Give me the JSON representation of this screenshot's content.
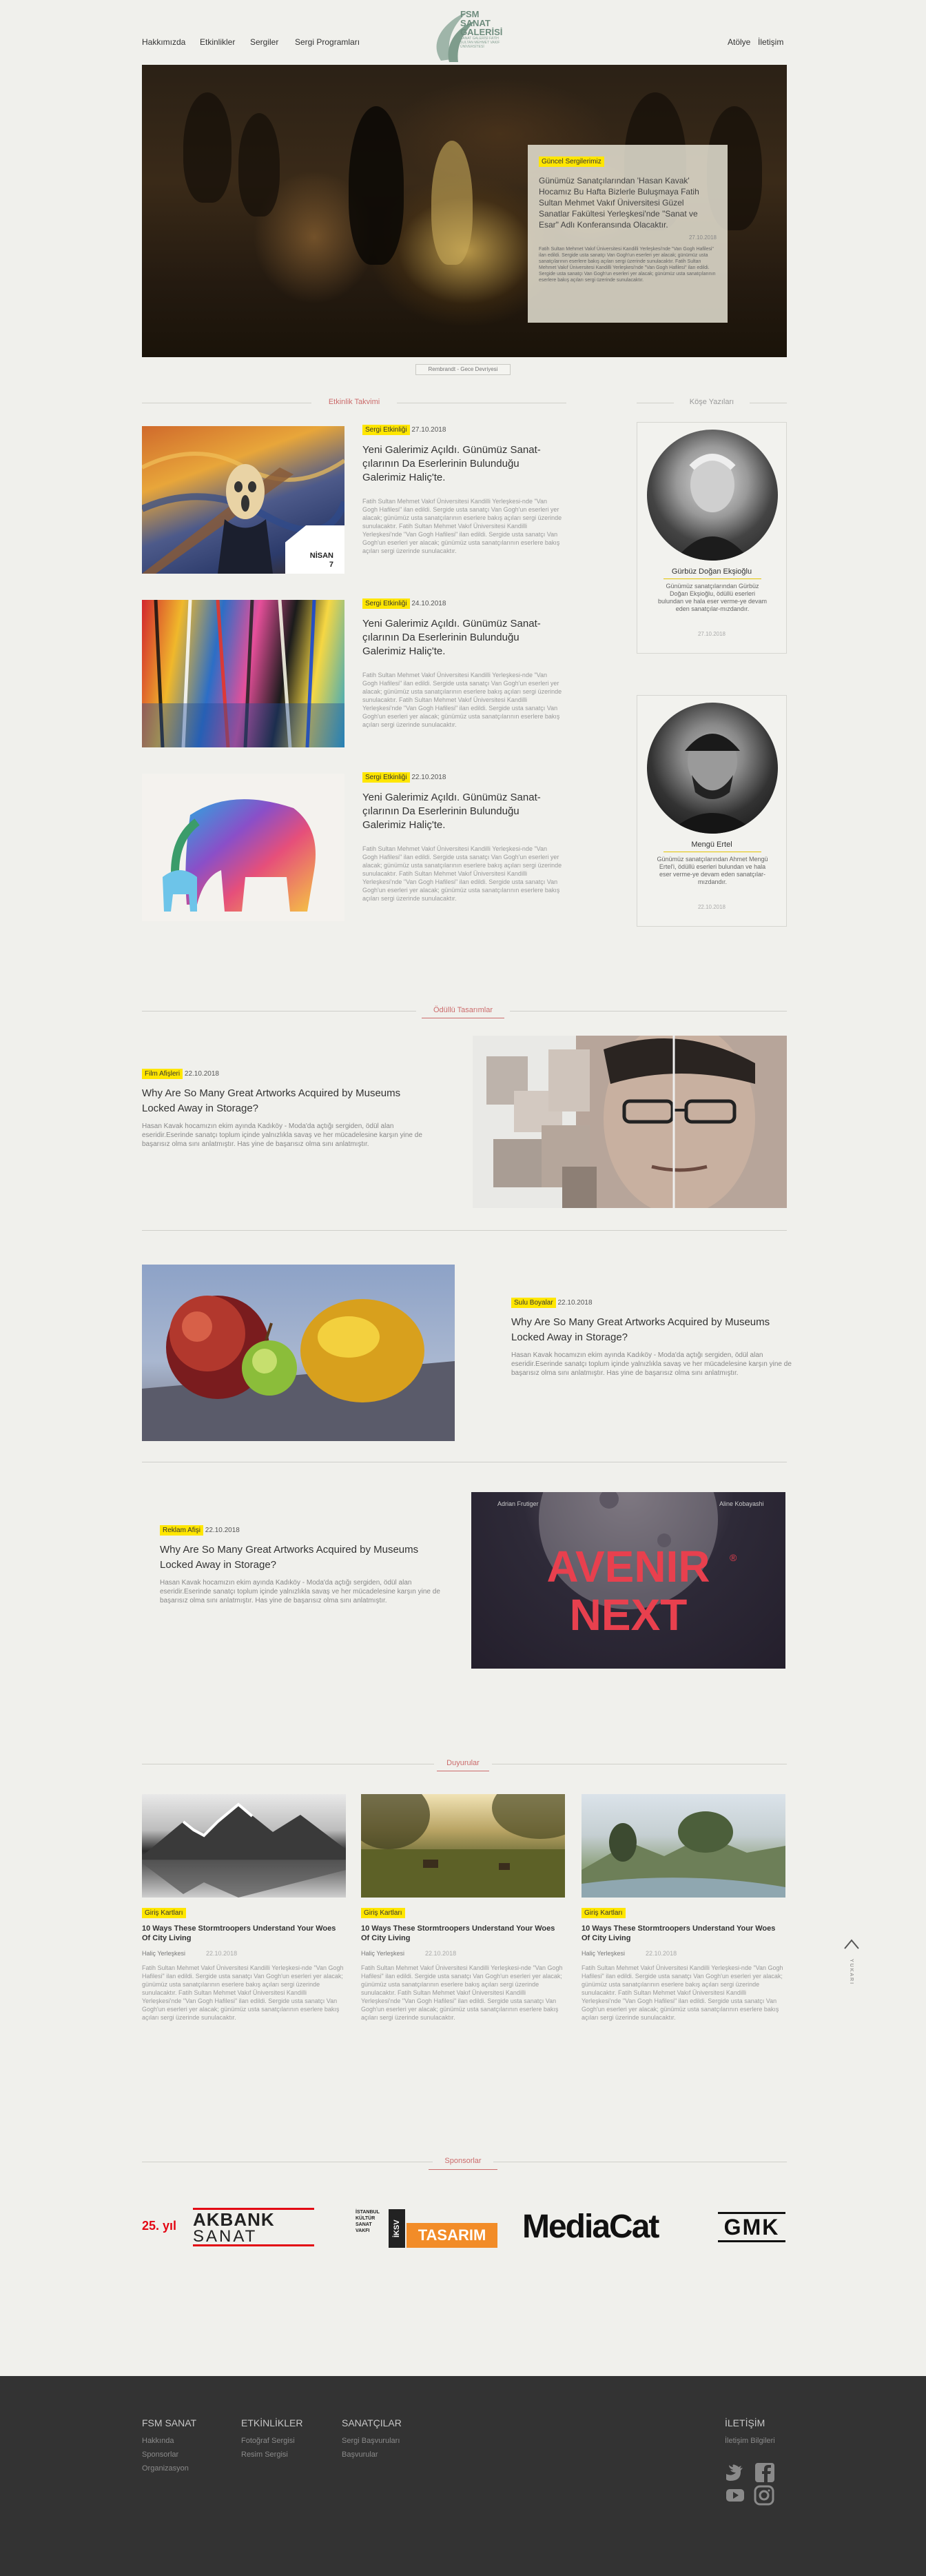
{
  "header": {
    "nav_left": [
      "Hakkımızda",
      "Etkinlikler",
      "Sergiler",
      "Sergi Programları"
    ],
    "nav_right": [
      "Atölye",
      "İletişim"
    ],
    "logo": {
      "line1": "FSM",
      "line2": "SANAT",
      "line3": "GALERİSİ",
      "sub": "SANAT GALERİSİ FATİH SULTAN MEHMET VAKIF ÜNİVERSİTESİ"
    }
  },
  "hero": {
    "tag": "Güncel Sergilerimiz",
    "title": "Günümüz Sanatçılarından 'Hasan Kavak' Hocamız Bu Hafta Bizlerle Buluşmaya Fatih Sultan Mehmet Vakıf Üniversitesi Güzel Sanatlar Fakültesi Yerleşkesi'nde \"Sanat ve Esar\" Adlı Konferansında Olacaktır.",
    "date": "27.10.2018",
    "body": "Fatih Sultan Mehmet Vakıf Üniversitesi Kandilli Yerleşkesi'nde \"Van Gogh Hafilesi\" ilan edildi. Sergide usta sanatçı Van Gogh'un eserleri yer alacak; günümüz usta sanatçılarının eserlere bakış açıları sergi üzerinde sunulacaktır. Fatih Sultan Mehmet Vakıf Üniversitesi Kandilli Yerleşkesi'nde \"Van Gogh Hafilesi\" ilan edildi. Sergide usta sanatçı Van Gogh'un eserleri yer alacak; günümüz usta sanatçılarının eserlere bakış açıları sergi üzerinde sunulacaktır.",
    "caption": "Rembrandt - Gece Devriyesi"
  },
  "sections": {
    "events": "Etkinlik Takvimi",
    "authors": "Köşe Yazıları",
    "awards": "Ödüllü Tasarımlar",
    "announcements": "Duyurular",
    "sponsors": "Sponsorlar"
  },
  "articles": [
    {
      "tag": "Sergi Etkinliği",
      "date": "27.10.2018",
      "title": "Yeni Galerimiz Açıldı. Günümüz Sanat-çılarının Da Eserlerinin Bulunduğu Galerimiz Haliç'te.",
      "body": "Fatih Sultan Mehmet Vakıf Üniversitesi Kandilli Yerleşkesi-nde \"Van Gogh Hafilesi\" ilan edildi. Sergide usta sanatçı Van Gogh'un eserleri yer alacak; günümüz usta sanatçılarının eserlere bakış açıları sergi üzerinde sunulacaktır. Fatih Sultan Mehmet Vakıf Üniversitesi Kandilli Yerleşkesi'nde \"Van Gogh Hafilesi\" ilan edildi. Sergide usta sanatçı Van Gogh'un eserleri yer alacak; günümüz usta sanatçılarının eserlere bakış açıları sergi üzerinde sunulacaktır.",
      "badge_line1": "NİSAN",
      "badge_line2": "7"
    },
    {
      "tag": "Sergi Etkinliği",
      "date": "24.10.2018",
      "title": "Yeni Galerimiz Açıldı. Günümüz Sanat-çılarının Da Eserlerinin Bulunduğu Galerimiz Haliç'te.",
      "body": "Fatih Sultan Mehmet Vakıf Üniversitesi Kandilli Yerleşkesi-nde \"Van Gogh Hafilesi\" ilan edildi. Sergide usta sanatçı Van Gogh'un eserleri yer alacak; günümüz usta sanatçılarının eserlere bakış açıları sergi üzerinde sunulacaktır. Fatih Sultan Mehmet Vakıf Üniversitesi Kandilli Yerleşkesi'nde \"Van Gogh Hafilesi\" ilan edildi. Sergide usta sanatçı Van Gogh'un eserleri yer alacak; günümüz usta sanatçılarının eserlere bakış açıları sergi üzerinde sunulacaktır."
    },
    {
      "tag": "Sergi Etkinliği",
      "date": "22.10.2018",
      "title": "Yeni Galerimiz Açıldı. Günümüz Sanat-çılarının Da Eserlerinin Bulunduğu Galerimiz Haliç'te.",
      "body": "Fatih Sultan Mehmet Vakıf Üniversitesi Kandilli Yerleşkesi-nde \"Van Gogh Hafilesi\" ilan edildi. Sergide usta sanatçı Van Gogh'un eserleri yer alacak; günümüz usta sanatçılarının eserlere bakış açıları sergi üzerinde sunulacaktır. Fatih Sultan Mehmet Vakıf Üniversitesi Kandilli Yerleşkesi'nde \"Van Gogh Hafilesi\" ilan edildi. Sergide usta sanatçı Van Gogh'un eserleri yer alacak; günümüz usta sanatçılarının eserlere bakış açıları sergi üzerinde sunulacaktır."
    }
  ],
  "authors": [
    {
      "name": "Gürbüz Doğan Ekşioğlu",
      "desc": "Günümüz sanatçılarından Gürbüz Doğan Ekşioğlu, ödüllü eserleri bulundan ve hala eser verme-ye devam eden sanatçılar-mızdandır.",
      "date": "27.10.2018"
    },
    {
      "name": "Mengü Ertel",
      "desc": "Günümüz sanatçılarından Ahmet Mengü Ertel'i, ödüllü eserleri bulundan ve hala eser verme-ye devam eden sanatçılar-mızdandır.",
      "date": "22.10.2018"
    }
  ],
  "awards": [
    {
      "tag": "Film Afişleri",
      "date": "22.10.2018",
      "title": "Why Are So Many Great Artworks Acquired by Museums Locked Away in Storage?",
      "body": "Hasan Kavak hocamızın ekim ayında Kadıköy - Moda'da açtığı sergiden, ödül alan eseridir.Eserinde sanatçı toplum içinde yalnızlıkla savaş ve her mücadelesine karşın yine de başarısız olma sını anlatmıştır. Has yine de başarısız olma sını anlatmıştır."
    },
    {
      "tag": "Sulu Boyalar",
      "date": "22.10.2018",
      "title": "Why Are So Many Great Artworks Acquired by Museums Locked Away in Storage?",
      "body": "Hasan Kavak hocamızın ekim ayında Kadıköy - Moda'da açtığı sergiden, ödül alan eseridir.Eserinde sanatçı toplum içinde yalnızlıkla savaş ve her mücadelesine karşın yine de başarısız olma sını anlatmıştır. Has yine de başarısız olma sını anlatmıştır."
    },
    {
      "tag": "Reklam Afişi",
      "date": "22.10.2018",
      "title": "Why Are So Many Great Artworks Acquired by Museums Locked Away in Storage?",
      "body": "Hasan Kavak hocamızın ekim ayında Kadıköy - Moda'da açtığı sergiden, ödül alan eseridir.Eserinde sanatçı toplum içinde yalnızlıkla savaş ve her mücadelesine karşın yine de başarısız olma sını anlatmıştır. Has yine de başarısız olma sını anlatmıştır."
    }
  ],
  "poster": {
    "top_left": "Adrian Frutiger",
    "top_right": "Aline Kobayashi",
    "line1": "AVENIR",
    "line2": "NEXT",
    "mark": "®"
  },
  "announcements": [
    {
      "tag": "Giriş Kartları",
      "title": "10 Ways These Stormtroopers Understand Your Woes Of City Living",
      "place": "Haliç Yerleşkesi",
      "date": "22.10.2018",
      "body": "Fatih Sultan Mehmet Vakıf Üniversitesi Kandilli Yerleşkesi-nde \"Van Gogh Hafilesi\" ilan edildi. Sergide usta sanatçı Van Gogh'un eserleri yer alacak; günümüz usta sanatçılarının eserlere bakış açıları sergi üzerinde sunulacaktır. Fatih Sultan Mehmet Vakıf Üniversitesi Kandilli Yerleşkesi'nde \"Van Gogh Hafilesi\" ilan edildi. Sergide usta sanatçı Van Gogh'un eserleri yer alacak; günümüz usta sanatçılarının eserlere bakış açıları sergi üzerinde sunulacaktır."
    },
    {
      "tag": "Giriş Kartları",
      "title": "10 Ways These Stormtroopers Understand Your Woes Of City Living",
      "place": "Haliç Yerleşkesi",
      "date": "22.10.2018",
      "body": "Fatih Sultan Mehmet Vakıf Üniversitesi Kandilli Yerleşkesi-nde \"Van Gogh Hafilesi\" ilan edildi. Sergide usta sanatçı Van Gogh'un eserleri yer alacak; günümüz usta sanatçılarının eserlere bakış açıları sergi üzerinde sunulacaktır. Fatih Sultan Mehmet Vakıf Üniversitesi Kandilli Yerleşkesi'nde \"Van Gogh Hafilesi\" ilan edildi. Sergide usta sanatçı Van Gogh'un eserleri yer alacak; günümüz usta sanatçılarının eserlere bakış açıları sergi üzerinde sunulacaktır."
    },
    {
      "tag": "Giriş Kartları",
      "title": "10 Ways These Stormtroopers Understand Your Woes Of City Living",
      "place": "Haliç Yerleşkesi",
      "date": "22.10.2018",
      "body": "Fatih Sultan Mehmet Vakıf Üniversitesi Kandilli Yerleşkesi-nde \"Van Gogh Hafilesi\" ilan edildi. Sergide usta sanatçı Van Gogh'un eserleri yer alacak; günümüz usta sanatçılarının eserlere bakış açıları sergi üzerinde sunulacaktır. Fatih Sultan Mehmet Vakıf Üniversitesi Kandilli Yerleşkesi'nde \"Van Gogh Hafilesi\" ilan edildi. Sergide usta sanatçı Van Gogh'un eserleri yer alacak; günümüz usta sanatçılarının eserlere bakış açıları sergi üzerinde sunulacaktır."
    }
  ],
  "back_to_top": "YUKARI",
  "sponsors": {
    "akbank_year": "25. yıl",
    "akbank_name": "AKBANK",
    "akbank_sub": "SANAT",
    "iksv_lines": [
      "İSTANBUL",
      "KÜLTÜR",
      "SANAT",
      "VAKFI"
    ],
    "iksv_mark": "İKSV",
    "iksv_word": "TASARIM",
    "mediacat": "MediaCat",
    "gmk": "GMK"
  },
  "footer": {
    "col1": {
      "title": "FSM SANAT",
      "links": [
        "Hakkında",
        "Sponsorlar",
        "Organizasyon"
      ]
    },
    "col2": {
      "title": "ETKİNLİKLER",
      "links": [
        "Fotoğraf Sergisi",
        "Resim Sergisi"
      ]
    },
    "col3": {
      "title": "SANATÇILAR",
      "links": [
        "Sergi Başvuruları",
        "Başvurular"
      ]
    },
    "col4": {
      "title": "İLETİŞİM",
      "links": [
        "İletişim Bilgileri"
      ]
    },
    "social": [
      "twitter-icon",
      "facebook-icon",
      "youtube-icon",
      "instagram-icon"
    ]
  },
  "colors": {
    "accent": "#ffe600",
    "section_title": "#cb6b6b",
    "footer_bg": "#333333",
    "page_bg": "#f0f0ec"
  }
}
